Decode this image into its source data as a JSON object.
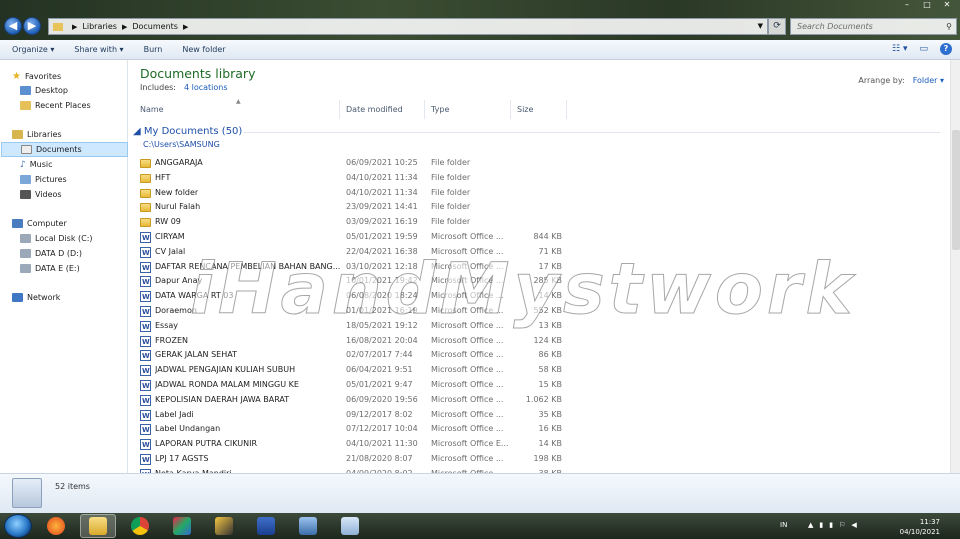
{
  "window": {
    "controls": [
      "–",
      "□",
      "✕"
    ]
  },
  "address": {
    "crumbs": [
      "Libraries",
      "Documents"
    ],
    "search_placeholder": "Search Documents"
  },
  "toolbar": {
    "organize": "Organize ▾",
    "share": "Share with ▾",
    "burn": "Burn",
    "new_folder": "New folder"
  },
  "nav": {
    "favorites": "Favorites",
    "desktop": "Desktop",
    "recent": "Recent Places",
    "libraries": "Libraries",
    "documents": "Documents",
    "music": "Music",
    "pictures": "Pictures",
    "videos": "Videos",
    "computer": "Computer",
    "local_disk": "Local Disk (C:)",
    "data_d": "DATA D (D:)",
    "data_e": "DATA E (E:)",
    "network": "Network"
  },
  "library": {
    "title": "Documents library",
    "includes_label": "Includes:",
    "includes_link": "4 locations",
    "arrange_label": "Arrange by:",
    "arrange_value": "Folder ▾"
  },
  "columns": {
    "name": "Name",
    "date": "Date modified",
    "type": "Type",
    "size": "Size"
  },
  "group": {
    "title": "◢ My Documents (50)",
    "path": "C:\\Users\\SAMSUNG"
  },
  "files": [
    {
      "name": "ANGGARAJA",
      "date": "06/09/2021 10:25",
      "type": "File folder",
      "size": "",
      "kind": "folder"
    },
    {
      "name": "HFT",
      "date": "04/10/2021 11:34",
      "type": "File folder",
      "size": "",
      "kind": "folder"
    },
    {
      "name": "New folder",
      "date": "04/10/2021 11:34",
      "type": "File folder",
      "size": "",
      "kind": "folder"
    },
    {
      "name": "Nurul Falah",
      "date": "23/09/2021 14:41",
      "type": "File folder",
      "size": "",
      "kind": "folder"
    },
    {
      "name": "RW 09",
      "date": "03/09/2021 16:19",
      "type": "File folder",
      "size": "",
      "kind": "folder"
    },
    {
      "name": "CIRYAM",
      "date": "05/01/2021 19:59",
      "type": "Microsoft Office ...",
      "size": "844 KB",
      "kind": "doc"
    },
    {
      "name": "CV Jalal",
      "date": "22/04/2021 16:38",
      "type": "Microsoft Office ...",
      "size": "71 KB",
      "kind": "doc"
    },
    {
      "name": "DAFTAR RENCANA PEMBELIAN BAHAN BANG...",
      "date": "03/10/2021 12:18",
      "type": "Microsoft Office ...",
      "size": "17 KB",
      "kind": "doc"
    },
    {
      "name": "Dapur Anay",
      "date": "10/01/2021 19:42",
      "type": "Microsoft Office ...",
      "size": "285 KB",
      "kind": "doc"
    },
    {
      "name": "DATA WARGA RT 03",
      "date": "06/08/2020 18:24",
      "type": "Microsoft Office ...",
      "size": "14 KB",
      "kind": "doc"
    },
    {
      "name": "Doraemon",
      "date": "01/01/2021 16:19",
      "type": "Microsoft Office ...",
      "size": "552 KB",
      "kind": "doc"
    },
    {
      "name": "Essay",
      "date": "18/05/2021 19:12",
      "type": "Microsoft Office ...",
      "size": "13 KB",
      "kind": "doc"
    },
    {
      "name": "FROZEN",
      "date": "16/08/2021 20:04",
      "type": "Microsoft Office ...",
      "size": "124 KB",
      "kind": "doc"
    },
    {
      "name": "GERAK JALAN SEHAT",
      "date": "02/07/2017 7:44",
      "type": "Microsoft Office ...",
      "size": "86 KB",
      "kind": "doc"
    },
    {
      "name": "JADWAL PENGAJIAN KULIAH SUBUH",
      "date": "06/04/2021 9:51",
      "type": "Microsoft Office ...",
      "size": "58 KB",
      "kind": "doc"
    },
    {
      "name": "JADWAL RONDA MALAM MINGGU KE",
      "date": "05/01/2021 9:47",
      "type": "Microsoft Office ...",
      "size": "15 KB",
      "kind": "doc"
    },
    {
      "name": "KEPOLISIAN DAERAH JAWA BARAT",
      "date": "06/09/2020 19:56",
      "type": "Microsoft Office ...",
      "size": "1.062 KB",
      "kind": "doc"
    },
    {
      "name": "Label Jadi",
      "date": "09/12/2017 8:02",
      "type": "Microsoft Office ...",
      "size": "35 KB",
      "kind": "doc"
    },
    {
      "name": "Label Undangan",
      "date": "07/12/2017 10:04",
      "type": "Microsoft Office ...",
      "size": "16 KB",
      "kind": "doc"
    },
    {
      "name": "LAPORAN PUTRA CIKUNIR",
      "date": "04/10/2021 11:30",
      "type": "Microsoft Office E...",
      "size": "14 KB",
      "kind": "doc"
    },
    {
      "name": "LPJ 17 AGSTS",
      "date": "21/08/2020 8:07",
      "type": "Microsoft Office ...",
      "size": "198 KB",
      "kind": "doc"
    },
    {
      "name": "Nota Karya Mandiri",
      "date": "04/09/2020 8:02",
      "type": "Microsoft Office ...",
      "size": "38 KB",
      "kind": "doc"
    }
  ],
  "status": {
    "count": "52 items"
  },
  "watermark": "iHandMystwork",
  "tray": {
    "lang": "IN",
    "time": "11:37",
    "date": "04/10/2021"
  },
  "colors": {
    "library_title": "#1e6b26",
    "link": "#1a5cbc",
    "selection": "#cde8ff"
  }
}
